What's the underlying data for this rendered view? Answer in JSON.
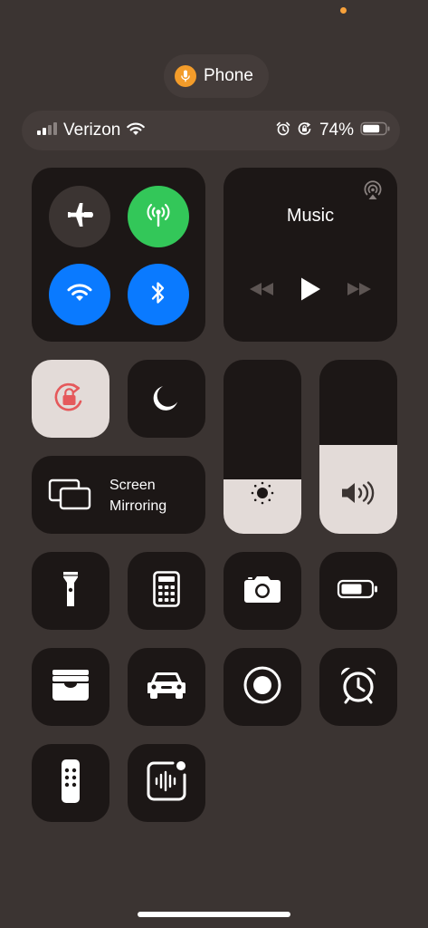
{
  "privacy_indicator": {
    "color": "#f7a13b"
  },
  "mic_indicator": {
    "app_label": "Phone",
    "icon": "microphone-icon",
    "color": "#f39c2a"
  },
  "status_bar": {
    "carrier": "Verizon",
    "battery_percent": "74%",
    "icons": [
      "cellular-signal-icon",
      "wifi-icon",
      "alarm-icon",
      "orientation-lock-icon",
      "battery-icon"
    ]
  },
  "connectivity": {
    "airplane_mode": {
      "icon": "airplane-icon",
      "on": false
    },
    "cellular_data": {
      "icon": "antenna-icon",
      "on": true,
      "color": "#33c759"
    },
    "wifi": {
      "icon": "wifi-icon",
      "on": true,
      "color": "#0a7aff"
    },
    "bluetooth": {
      "icon": "bluetooth-icon",
      "on": true,
      "color": "#0a7aff"
    }
  },
  "music": {
    "title": "Music",
    "icons": [
      "airplay-icon",
      "rewind-icon",
      "play-icon",
      "fast-forward-icon"
    ]
  },
  "orientation_lock": {
    "icon": "orientation-lock-icon",
    "on": true,
    "color": "#e5595b"
  },
  "focus": {
    "icon": "moon-icon"
  },
  "screen_mirroring": {
    "line1": "Screen",
    "line2": "Mirroring",
    "icon": "screen-mirroring-icon"
  },
  "brightness": {
    "icon": "sun-icon",
    "level": 0.31
  },
  "volume": {
    "icon": "speaker-icon",
    "level": 0.51
  },
  "shortcuts": [
    {
      "name": "flashlight",
      "icon": "flashlight-icon"
    },
    {
      "name": "calculator",
      "icon": "calculator-icon"
    },
    {
      "name": "camera",
      "icon": "camera-icon"
    },
    {
      "name": "low-power-mode",
      "icon": "battery-icon"
    },
    {
      "name": "wallet",
      "icon": "wallet-icon"
    },
    {
      "name": "driving-focus",
      "icon": "car-icon"
    },
    {
      "name": "screen-recording",
      "icon": "record-icon"
    },
    {
      "name": "alarm",
      "icon": "alarm-clock-icon"
    },
    {
      "name": "apple-tv-remote",
      "icon": "remote-icon"
    },
    {
      "name": "sound-recognition",
      "icon": "sound-recognition-icon"
    }
  ]
}
